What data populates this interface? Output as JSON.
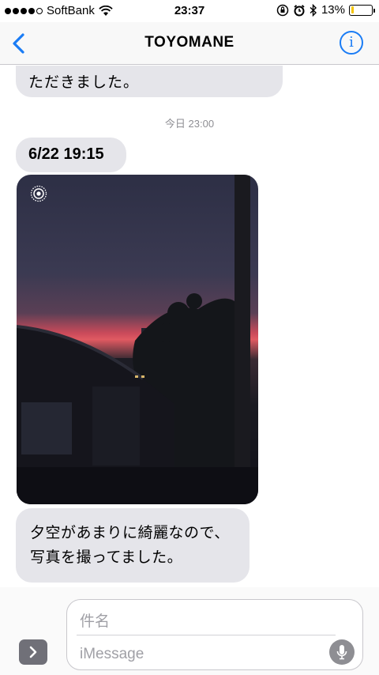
{
  "status_bar": {
    "carrier": "SoftBank",
    "time": "23:37",
    "battery_percent": "13%",
    "battery_level": 0.13,
    "colors": {
      "battery": "#f5c400"
    }
  },
  "nav": {
    "title": "TOYOMANE",
    "info_label": "i",
    "accent": "#1a7cf5"
  },
  "messages": {
    "previous_tail": "ただきました。",
    "timestamp": "今日 23:00",
    "date_bubble": "6/22 19:15",
    "photo_alt": "sunset-photo",
    "text_line1": "夕空があまりに綺麗なので、",
    "text_line2": "写真を撮ってました。"
  },
  "input": {
    "subject_placeholder": "件名",
    "message_placeholder": "iMessage"
  }
}
